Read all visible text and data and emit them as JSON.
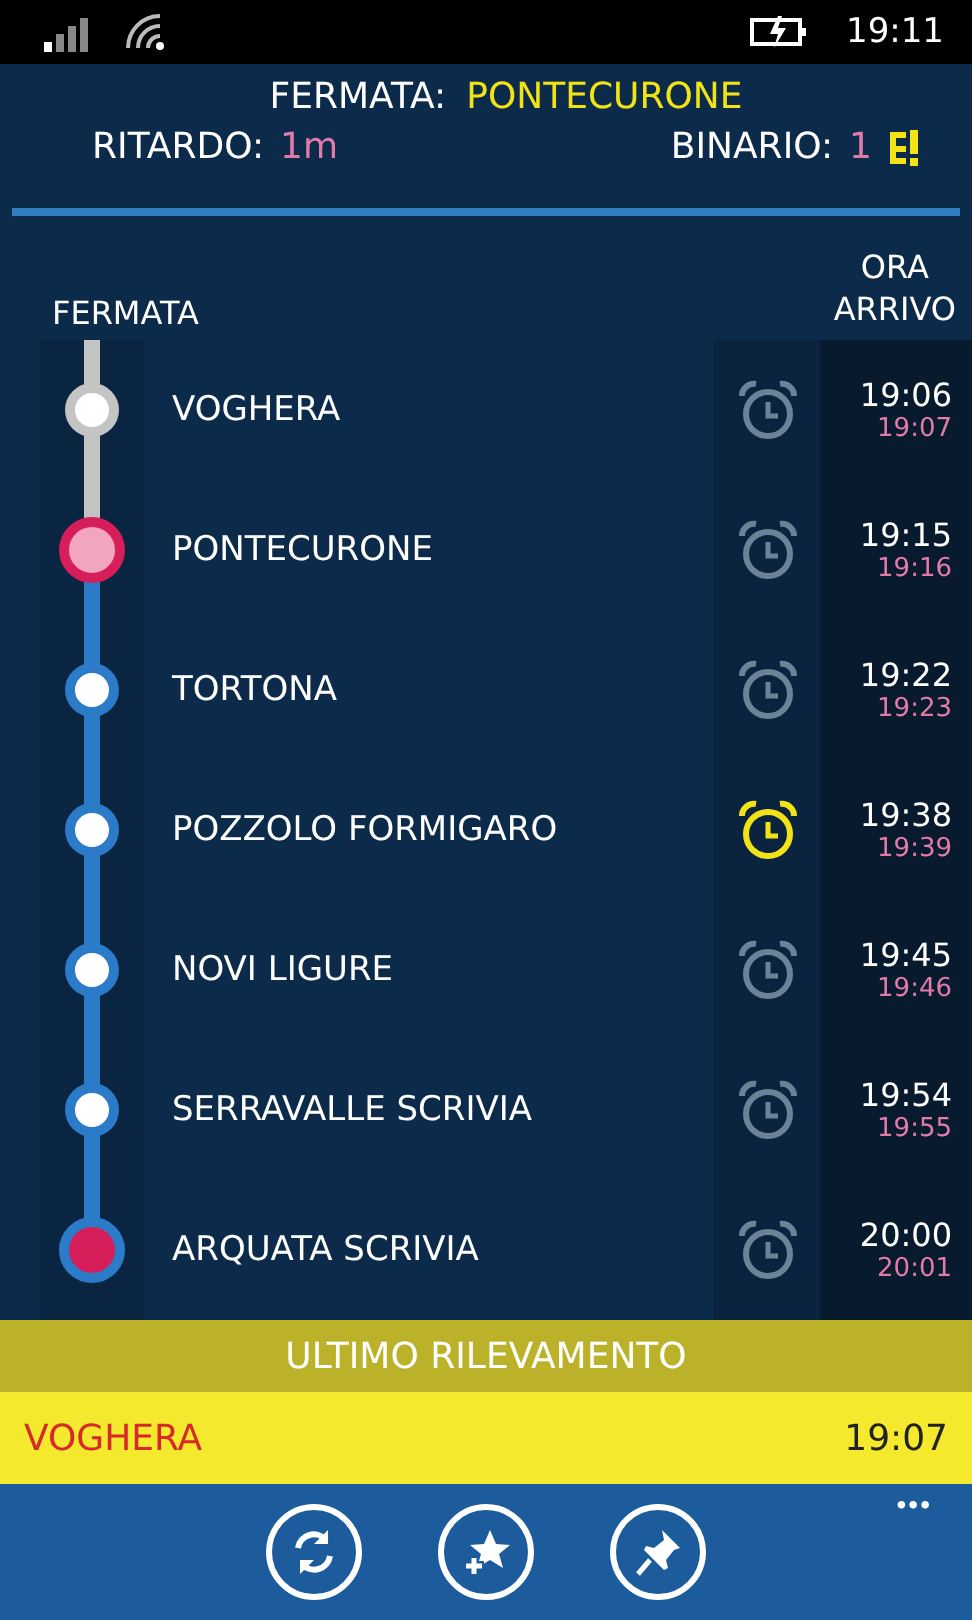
{
  "status_bar": {
    "time": "19:11"
  },
  "header": {
    "stop_label": "FERMATA:",
    "stop_value": "PONTECURONE",
    "delay_label": "RITARDO:",
    "delay_value": "1m",
    "platform_label": "BINARIO:",
    "platform_value": "1"
  },
  "columns": {
    "stop": "FERMATA",
    "arrival": "ORA\nARRIVO"
  },
  "stops": [
    {
      "name": "VOGHERA",
      "kind": "passed",
      "alarm": false,
      "scheduled": "19:06",
      "actual": "19:07"
    },
    {
      "name": "PONTECURONE",
      "kind": "current",
      "alarm": false,
      "scheduled": "19:15",
      "actual": "19:16"
    },
    {
      "name": "TORTONA",
      "kind": "upcoming",
      "alarm": false,
      "scheduled": "19:22",
      "actual": "19:23"
    },
    {
      "name": "POZZOLO FORMIGARO",
      "kind": "upcoming",
      "alarm": true,
      "scheduled": "19:38",
      "actual": "19:39"
    },
    {
      "name": "NOVI LIGURE",
      "kind": "upcoming",
      "alarm": false,
      "scheduled": "19:45",
      "actual": "19:46"
    },
    {
      "name": "SERRAVALLE SCRIVIA",
      "kind": "upcoming",
      "alarm": false,
      "scheduled": "19:54",
      "actual": "19:55"
    },
    {
      "name": "ARQUATA SCRIVIA",
      "kind": "terminus",
      "alarm": false,
      "scheduled": "20:00",
      "actual": "20:01"
    }
  ],
  "last_report": {
    "title": "ULTIMO RILEVAMENTO",
    "station": "VOGHERA",
    "time": "19:07"
  },
  "app_bar": {
    "more": "•••"
  }
}
